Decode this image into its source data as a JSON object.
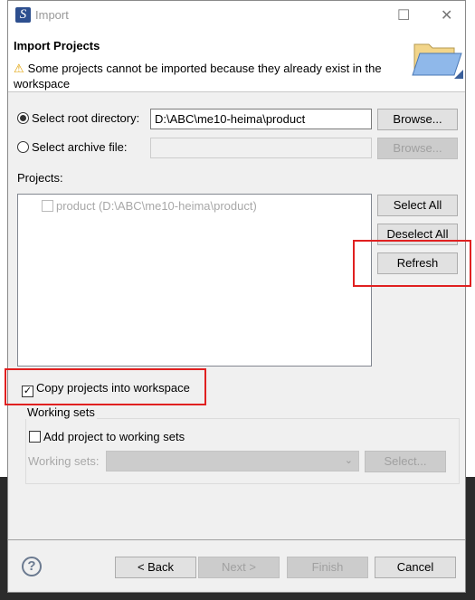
{
  "window": {
    "title": "Import",
    "maximize_icon": "maximize-icon",
    "close_icon": "close-icon"
  },
  "header": {
    "title": "Import Projects",
    "message": "Some projects cannot be imported because they already exist in the workspace",
    "warning_icon": "warning-icon",
    "banner_icon": "folder-icon"
  },
  "source": {
    "root_label": "Select root directory:",
    "root_value": "D:\\ABC\\me10-heima\\product",
    "root_selected": true,
    "archive_label": "Select archive file:",
    "archive_value": "",
    "browse_label": "Browse...",
    "browse2_label": "Browse..."
  },
  "projects": {
    "label": "Projects:",
    "items": [
      {
        "label": "product (D:\\ABC\\me10-heima\\product)",
        "checked": false,
        "disabled": true
      }
    ],
    "select_all": "Select All",
    "deselect_all": "Deselect All",
    "refresh": "Refresh"
  },
  "options": {
    "copy_label": "Copy projects into workspace",
    "copy_checked": true
  },
  "working_sets": {
    "title": "Working sets",
    "add_label": "Add project to working sets",
    "add_checked": false,
    "sets_label": "Working sets:",
    "sets_value": "",
    "select_label": "Select..."
  },
  "footer": {
    "back": "< Back",
    "next": "Next >",
    "finish": "Finish",
    "cancel": "Cancel",
    "help_icon": "help-icon"
  },
  "colors": {
    "highlight": "#e02020"
  }
}
